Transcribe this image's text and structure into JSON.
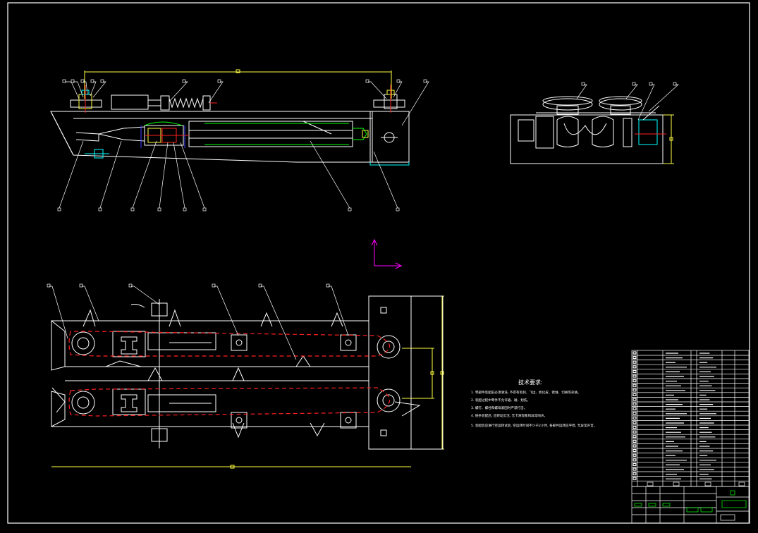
{
  "drawing": {
    "background": "#000000",
    "colors": {
      "outline": "#ffffff",
      "chain": "#ff2020",
      "dimension": "#ffff40",
      "accent_green": "#00ff00",
      "accent_cyan": "#00ffff",
      "accent_blue": "#4040ff",
      "ucs_icon": "#ff00ff"
    },
    "technical_requirements": {
      "title": "技术要求:",
      "lines": [
        "1. 零部件装配前必须清洗, 不得有毛刺、飞边、氧化皮、锈蚀、切屑等杂质。",
        "2. 装配过程中零件不允许磕、碰、划伤。",
        "3. 螺钉、螺栓和螺母紧固时严禁打击。",
        "4. 链条装配后, 应转动灵活, 无卡滞现象和异常响声。",
        "5. 装配后应进行空运转试验, 空运转时间不少于2小时, 各部件运转应平稳, 无异常声音。"
      ]
    },
    "icons": [
      "ucs-axis-icon"
    ]
  }
}
